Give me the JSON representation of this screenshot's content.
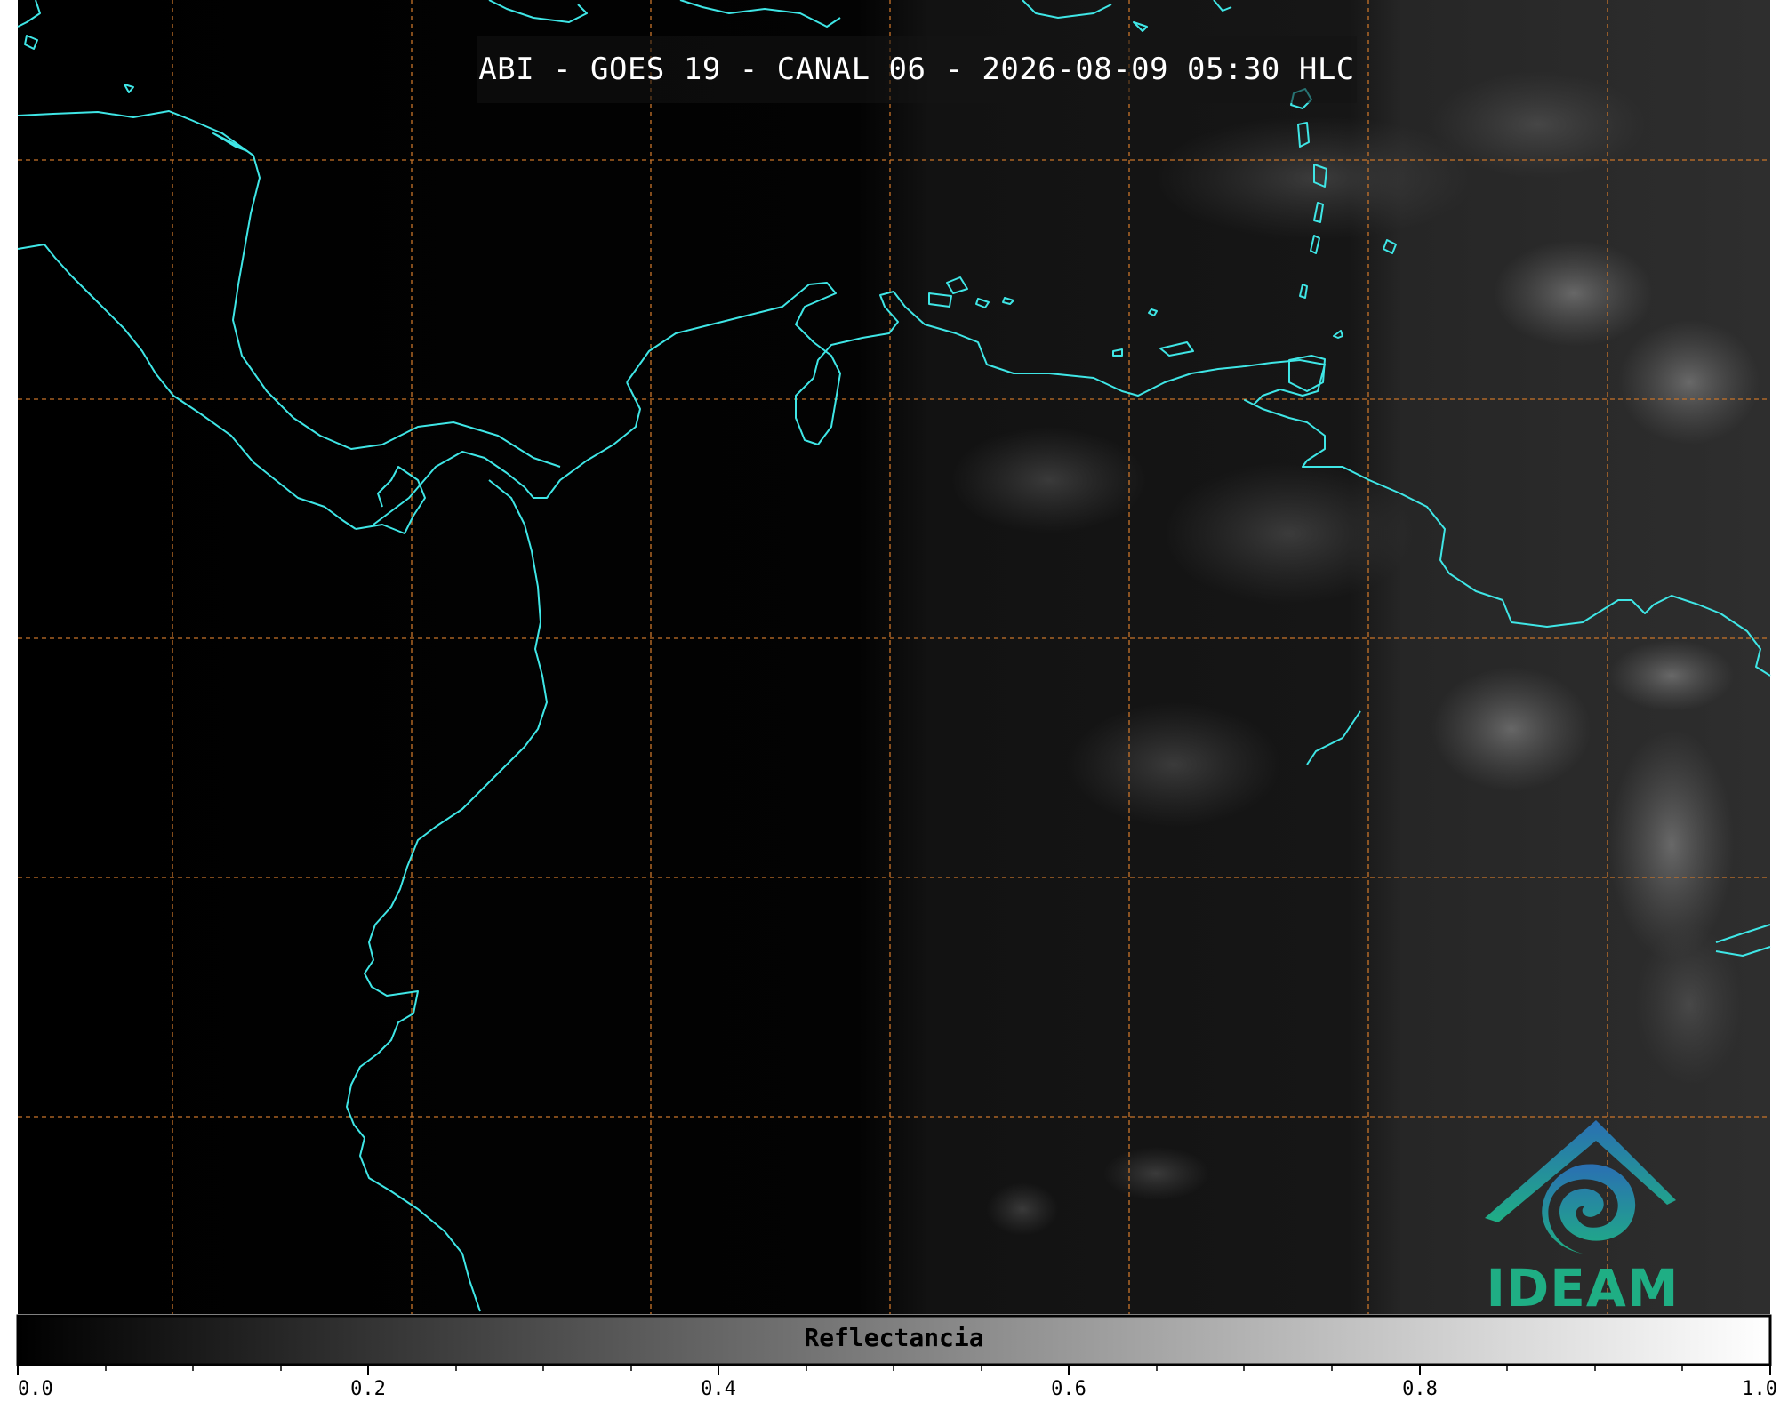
{
  "title": "ABI - GOES 19 - CANAL 06 - 2026-08-09 05:30 HLC",
  "logo": {
    "text": "IDEAM",
    "icon": "ideam-logo-icon",
    "colors": [
      "#2a6fb3",
      "#1fae84"
    ]
  },
  "colorbar": {
    "label": "Reflectancia",
    "range": [
      0.0,
      1.0
    ],
    "ticks": [
      "0.0",
      "0.2",
      "0.4",
      "0.6",
      "0.8",
      "1.0"
    ],
    "colormap": "grayscale black-to-white"
  },
  "map": {
    "coastline_color": "#3fe6e6",
    "gridline_color": "#c8742a",
    "gridline_style": "dashed"
  }
}
